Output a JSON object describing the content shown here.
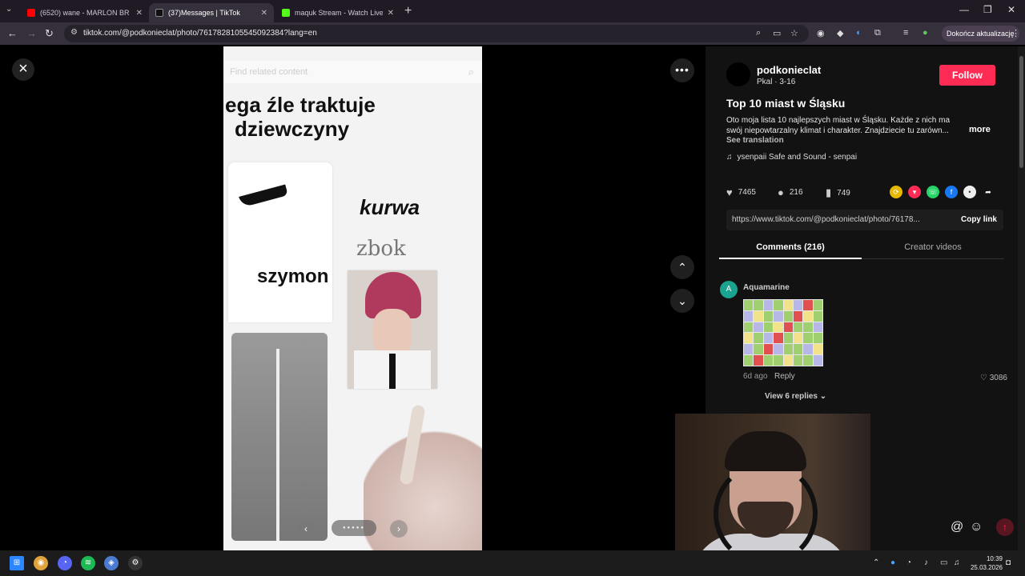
{
  "browser": {
    "tabs": [
      {
        "title": "(6520) wane - MARLON BR",
        "favicon_color": "#ff0000",
        "active": false
      },
      {
        "title": "(37)Messages | TikTok",
        "favicon_color": "#111111",
        "active": true
      },
      {
        "title": "maquk Stream - Watch Live on",
        "favicon_color": "#53fc18",
        "active": false
      }
    ],
    "new_tab": "+",
    "url": "tiktok.com/@podkonieclat/photo/7617828105545092384?lang=en",
    "update_button": "Dokończ aktualizację"
  },
  "viewer": {
    "search_placeholder": "Find related content",
    "headline_line1": "ega źle traktuje",
    "headline_line2": "dziewczyny",
    "word_kurwa": "kurwa",
    "word_zbok": "zbok",
    "word_szymon": "szymon",
    "carousel_total": 5,
    "carousel_current": 4
  },
  "post": {
    "username": "podkonieclat",
    "subline": "Pkal · 3-16",
    "follow_label": "Follow",
    "title": "Top 10 miast w Śląsku",
    "description": "Oto moja lista 10 najlepszych miast w Śląsku. Każde z nich ma swój niepowtarzalny klimat i charakter. Znajdziecie tu zarówn...",
    "more_label": "more",
    "see_translation": "See translation",
    "music": "ysenpaii Safe and Sound - senpai",
    "likes": "7465",
    "comments_count": "216",
    "saves": "749",
    "share_url": "https://www.tiktok.com/@podkonieclat/photo/76178...",
    "copy_link": "Copy link",
    "tab_comments": "Comments (216)",
    "tab_creator": "Creator videos"
  },
  "comment": {
    "avatar_letter": "A",
    "author": "Aquamarine",
    "time": "6d ago",
    "reply": "Reply",
    "likes": "3086",
    "view_replies": "View 6 replies"
  },
  "taskbar": {
    "time": "10:39",
    "date": "25.03.2026"
  },
  "colors": {
    "tiktok_red": "#fe2c55",
    "panel_bg": "#121212"
  }
}
